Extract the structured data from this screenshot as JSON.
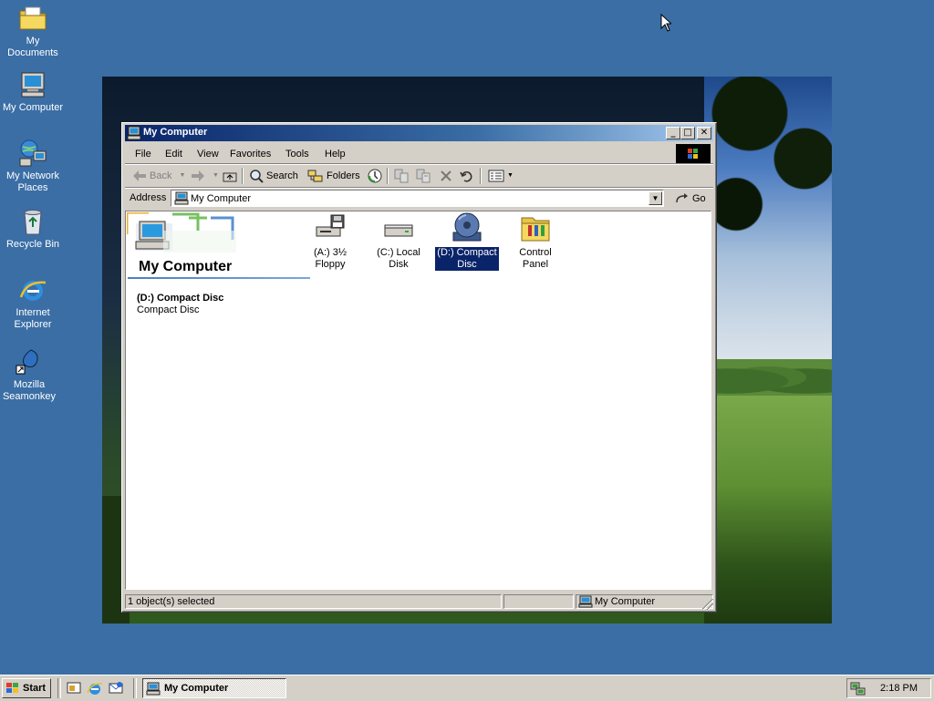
{
  "desktop": {
    "icons": [
      {
        "label": "My Documents",
        "icon": "folder-documents-icon"
      },
      {
        "label": "My Computer",
        "icon": "computer-icon"
      },
      {
        "label": "My Network Places",
        "icon": "network-icon"
      },
      {
        "label": "Recycle Bin",
        "icon": "recycle-bin-icon"
      },
      {
        "label": "Internet Explorer",
        "icon": "internet-explorer-icon"
      },
      {
        "label": "Mozilla Seamonkey",
        "icon": "seamonkey-icon"
      }
    ],
    "background_color": "#3a6ea5"
  },
  "window": {
    "title": "My Computer",
    "controls": {
      "minimize": "_",
      "maximize": "□",
      "close": "✕"
    },
    "menu": [
      "File",
      "Edit",
      "View",
      "Favorites",
      "Tools",
      "Help"
    ],
    "toolbar": {
      "back": "Back",
      "search": "Search",
      "folders": "Folders"
    },
    "address": {
      "label": "Address",
      "value": "My Computer",
      "go": "Go"
    },
    "banner": {
      "title": "My Computer"
    },
    "selection": {
      "name": "(D:) Compact Disc",
      "type": "Compact Disc"
    },
    "items": [
      {
        "label": "(A:) 3½ Floppy",
        "icon": "floppy-drive-icon",
        "selected": false
      },
      {
        "label": "(C:) Local Disk",
        "icon": "hard-disk-icon",
        "selected": false
      },
      {
        "label": "(D:) Compact Disc",
        "icon": "cd-drive-icon",
        "selected": true
      },
      {
        "label": "Control Panel",
        "icon": "control-panel-icon",
        "selected": false
      }
    ],
    "status": {
      "left": "1 object(s) selected",
      "right": "My Computer"
    }
  },
  "taskbar": {
    "start": "Start",
    "task": "My Computer",
    "clock": "2:18 PM"
  },
  "colors": {
    "title_active_start": "#0a246a",
    "title_active_end": "#a6caf0",
    "selection": "#0a246a",
    "face": "#d4d0c8"
  }
}
